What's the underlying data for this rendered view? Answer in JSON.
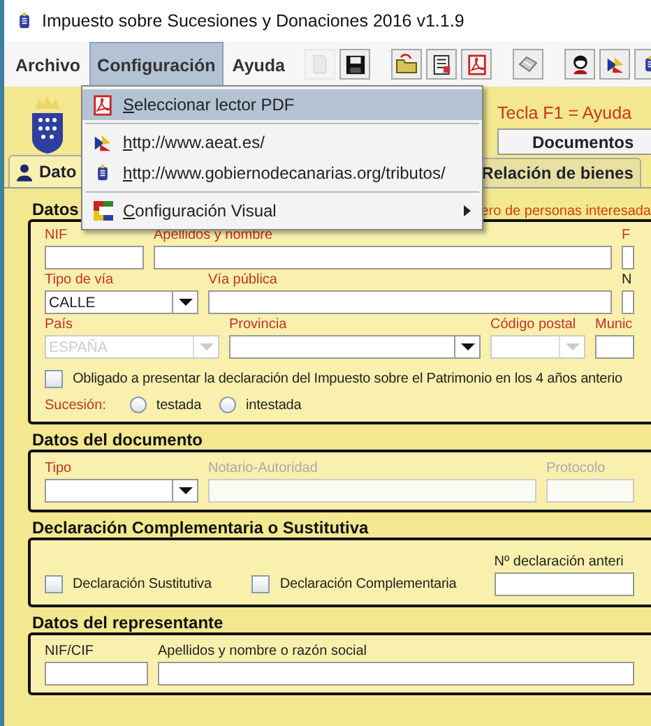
{
  "window": {
    "title": "Impuesto sobre Sucesiones y Donaciones 2016 v1.1.9"
  },
  "menu_bar": [
    {
      "label": "Archivo",
      "selected": false
    },
    {
      "label": "Configuración",
      "selected": true
    },
    {
      "label": "Ayuda",
      "selected": false
    }
  ],
  "toolbar": [
    {
      "kind": "new",
      "disabled": true
    },
    {
      "kind": "save",
      "disabled": false
    },
    {
      "kind": "open",
      "disabled": false
    },
    {
      "kind": "form",
      "disabled": false
    },
    {
      "kind": "pdf",
      "disabled": false
    },
    {
      "kind": "print",
      "disabled": false
    },
    {
      "kind": "user",
      "disabled": false
    },
    {
      "kind": "aeat",
      "disabled": false
    },
    {
      "kind": "canarias",
      "disabled": false
    }
  ],
  "menu": {
    "groups": [
      [
        {
          "label": "Seleccionar lector PDF",
          "selected": true,
          "submenu": false
        }
      ],
      [
        {
          "label": "http://www.aeat.es/",
          "selected": false,
          "submenu": false
        },
        {
          "label": "http://www.gobiernodecanarias.org/tributos/",
          "selected": false,
          "submenu": false
        }
      ],
      [
        {
          "label": "Configuración Visual",
          "selected": false,
          "submenu": true
        }
      ]
    ]
  },
  "header": {
    "help_hint": "Tecla F1 = Ayuda",
    "documents_button": "Documentos"
  },
  "tabs": [
    {
      "label": "Dato",
      "selected": true
    },
    {
      "label": "Relación de bienes",
      "selected": false
    }
  ],
  "sections": [
    {
      "title": "Datos",
      "note": "ero de personas interesada",
      "rows": [
        [
          {
            "kind": "text",
            "label": "NIF",
            "required": true,
            "disabled": false
          },
          {
            "kind": "text",
            "label": "Apellidos y nombre",
            "required": true,
            "disabled": false
          },
          {
            "kind": "text",
            "label": "F",
            "required": true,
            "disabled": false
          }
        ],
        [
          {
            "kind": "combo",
            "label": "Tipo de vía",
            "required": true,
            "disabled": false,
            "value": "CALLE"
          },
          {
            "kind": "text",
            "label": "Vía pública",
            "required": true,
            "disabled": false
          },
          {
            "kind": "text",
            "label": "N",
            "required": false,
            "disabled": false
          }
        ],
        [
          {
            "kind": "combo",
            "label": "País",
            "required": true,
            "disabled": true,
            "value": "ESPAÑA"
          },
          {
            "kind": "combo",
            "label": "Provincia",
            "required": true,
            "disabled": false
          },
          {
            "kind": "combo",
            "label": "Código postal",
            "required": true,
            "disabled": true
          },
          {
            "kind": "text",
            "label": "Munic",
            "required": true,
            "disabled": false
          }
        ],
        [
          {
            "kind": "checkbox",
            "label": "Obligado a presentar la declaración del Impuesto sobre el Patrimonio en los 4 años anterio",
            "checked": false
          }
        ],
        [
          {
            "kind": "radios",
            "label": "Sucesión:",
            "required": true,
            "options": [
              {
                "label": "testada",
                "selected": false
              },
              {
                "label": "intestada",
                "selected": false
              }
            ]
          }
        ]
      ]
    },
    {
      "title": "Datos del documento",
      "rows": [
        [
          {
            "kind": "combo",
            "label": "Tipo",
            "required": true,
            "disabled": false
          },
          {
            "kind": "text",
            "label": "Notario-Autoridad",
            "required": false,
            "disabled": true
          },
          {
            "kind": "text",
            "label": "Protocolo",
            "required": false,
            "disabled": true
          }
        ]
      ]
    },
    {
      "title": "Declaración Complementaria o Sustitutiva",
      "rows": [
        [
          {
            "kind": "checkbox",
            "label": "Declaración Sustitutiva",
            "checked": false
          },
          {
            "kind": "checkbox",
            "label": "Declaración Complementaria",
            "checked": false
          },
          {
            "kind": "text",
            "label": "Nº declaración anteri",
            "required": false,
            "disabled": false
          }
        ]
      ]
    },
    {
      "title": "Datos del representante",
      "rows": [
        [
          {
            "kind": "text",
            "label": "NIF/CIF",
            "required": false,
            "disabled": false
          },
          {
            "kind": "text",
            "label": "Apellidos y nombre o razón social",
            "required": false,
            "disabled": false
          }
        ]
      ]
    }
  ]
}
